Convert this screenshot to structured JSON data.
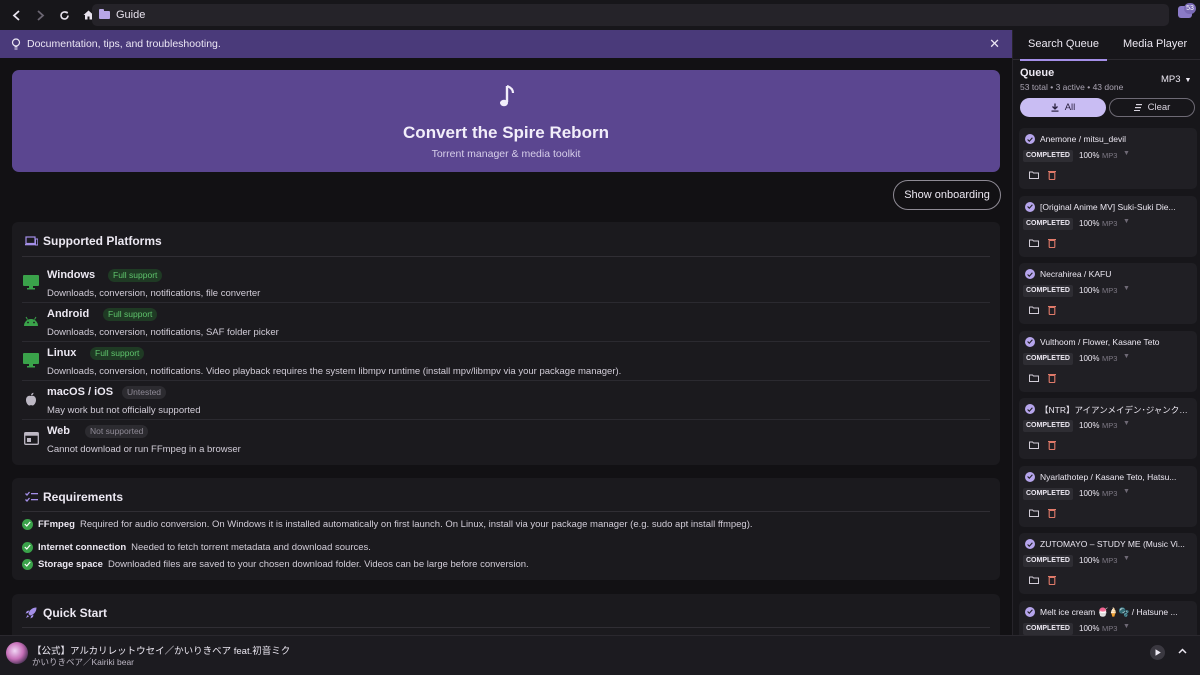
{
  "topbar": {
    "page_title": "Guide",
    "notifications": "53"
  },
  "banner": {
    "text": "Documentation, tips, and troubleshooting."
  },
  "hero": {
    "title": "Convert the Spire Reborn",
    "subtitle": "Torrent manager & media toolkit"
  },
  "onboarding_button": "Show onboarding",
  "platforms": {
    "title": "Supported Platforms",
    "items": [
      {
        "name": "Windows",
        "badge": "Full support",
        "desc": "Downloads, conversion, notifications, file converter",
        "icon": "monitor-icon",
        "badge_color": "#5fc46c"
      },
      {
        "name": "Android",
        "badge": "Full support",
        "desc": "Downloads, conversion, notifications, SAF folder picker",
        "icon": "android-icon",
        "badge_color": "#5fc46c"
      },
      {
        "name": "Linux",
        "badge": "Full support",
        "desc": "Downloads, conversion, notifications. Video playback requires the system libmpv runtime (install mpv/libmpv via your package manager).",
        "icon": "monitor-icon",
        "badge_color": "#5fc46c"
      },
      {
        "name": "macOS / iOS",
        "badge": "Untested",
        "desc": "May work but not officially supported",
        "icon": "apple-icon",
        "badge_color": "#8f8a96"
      },
      {
        "name": "Web",
        "badge": "Not supported",
        "desc": "Cannot download or run FFmpeg in a browser",
        "icon": "browser-icon",
        "badge_color": "#8f8a96"
      }
    ]
  },
  "requirements": {
    "title": "Requirements",
    "items": [
      {
        "label": "FFmpeg",
        "desc": "Required for audio conversion. On Windows it is installed automatically on first launch. On Linux, install via your package manager (e.g. sudo apt install ffmpeg)."
      },
      {
        "label": "Internet connection",
        "desc": "Needed to fetch torrent metadata and download sources."
      },
      {
        "label": "Storage space",
        "desc": "Downloaded files are saved to your chosen download folder. Videos can be large before conversion."
      }
    ]
  },
  "quickstart": {
    "title": "Quick Start"
  },
  "panel": {
    "tabs": [
      "Search Queue",
      "Media Player"
    ],
    "queue_title": "Queue",
    "queue_stats": "53 total • 3 active • 43 done",
    "format": "MP3",
    "all_label": "All",
    "clear_label": "Clear",
    "items": [
      {
        "title": "Anemone / mitsu_devil",
        "status": "COMPLETED",
        "progress": "100%",
        "format": "MP3"
      },
      {
        "title": "[Original Anime MV] Suki-Suki Die...",
        "status": "COMPLETED",
        "progress": "100%",
        "format": "MP3"
      },
      {
        "title": "Necrahirea / KAFU",
        "status": "COMPLETED",
        "progress": "100%",
        "format": "MP3"
      },
      {
        "title": "Vulthoom / Flower, Kasane Teto",
        "status": "COMPLETED",
        "progress": "100%",
        "format": "MP3"
      },
      {
        "title": "【NTR】アイアンメイデン･ジャンク(Iron M...",
        "status": "COMPLETED",
        "progress": "100%",
        "format": "MP3"
      },
      {
        "title": "Nyarlathotep / Kasane Teto, Hatsu...",
        "status": "COMPLETED",
        "progress": "100%",
        "format": "MP3"
      },
      {
        "title": "ZUTOMAYO – STUDY ME (Music Vi...",
        "status": "COMPLETED",
        "progress": "100%",
        "format": "MP3"
      },
      {
        "title": "Melt ice cream 🍧🍦🫧 / Hatsune ...",
        "status": "COMPLETED",
        "progress": "100%",
        "format": "MP3"
      }
    ]
  },
  "player": {
    "title": "【公式】アルカリレットウセイ／かいりきベア feat.初音ミク",
    "artist": "かいりきベア／Kairiki bear"
  },
  "colors": {
    "accent": "#a48fe8",
    "hero": "#5b4690",
    "banner": "#4a3a7a",
    "success": "#3aa24a"
  }
}
